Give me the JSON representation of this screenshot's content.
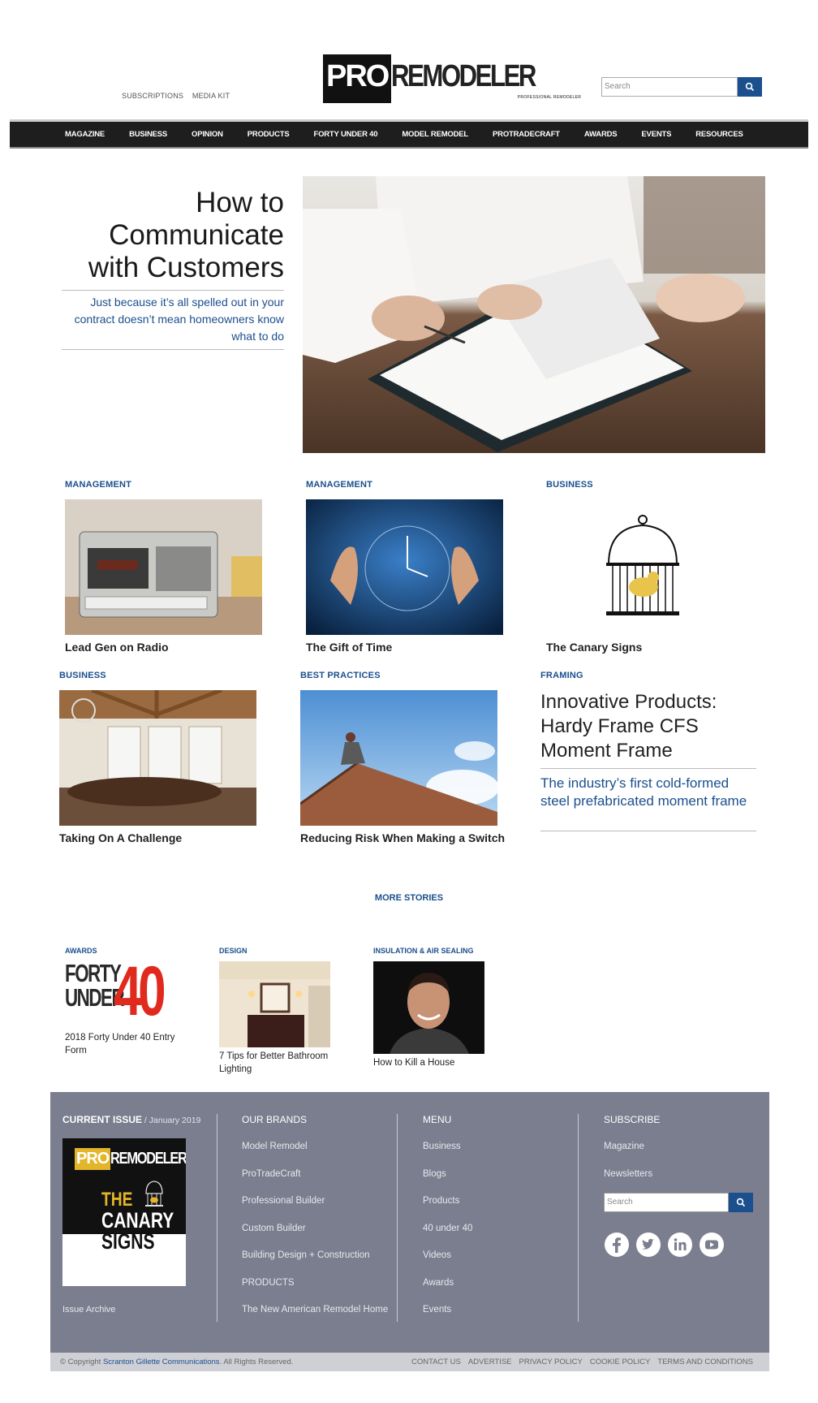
{
  "header": {
    "top_links": [
      "SUBSCRIPTIONS",
      "MEDIA KIT"
    ],
    "logo_pro": "PRO",
    "logo_rest": "REMODELER",
    "logo_sub": "PROFESSIONAL REMODELER",
    "search_placeholder": "Search"
  },
  "nav": [
    "MAGAZINE",
    "BUSINESS",
    "OPINION",
    "PRODUCTS",
    "FORTY UNDER 40",
    "MODEL REMODEL",
    "PROTRADECRAFT",
    "AWARDS",
    "EVENTS",
    "RESOURCES"
  ],
  "hero": {
    "title": "How to Communicate with Customers",
    "subtitle": "Just because it’s all spelled out in your contract doesn’t mean homeowners know what to do"
  },
  "grid_row1": [
    {
      "category": "MANAGEMENT",
      "caption": "Lead Gen on Radio"
    },
    {
      "category": "MANAGEMENT",
      "caption": "The Gift of Time"
    },
    {
      "category": "BUSINESS",
      "caption": "The Canary Signs"
    }
  ],
  "grid_row2": [
    {
      "category": "BUSINESS",
      "caption": "Taking On A Challenge"
    },
    {
      "category": "BEST PRACTICES",
      "caption": "Reducing Risk When Making a Switch"
    }
  ],
  "feature": {
    "category": "FRAMING",
    "title": "Innovative Products: Hardy Frame CFS Moment Frame",
    "subtitle": "The industry’s first cold-formed steel prefabricated moment frame"
  },
  "more_stories": "MORE STORIES",
  "small_stories": [
    {
      "category": "AWARDS",
      "caption": "2018 Forty Under 40 Entry Form",
      "logo_line1": "FORTY",
      "logo_line2": "UNDER",
      "logo_num": "40"
    },
    {
      "category": "DESIGN",
      "caption": "7 Tips for Better Bathroom Lighting"
    },
    {
      "category": "INSULATION & AIR SEALING",
      "caption": "How to Kill a House"
    }
  ],
  "footer": {
    "current_issue_label": "CURRENT ISSUE",
    "current_issue_date": " / January 2019",
    "cover_pro": "PRO",
    "cover_rest": "REMODELER",
    "cover_title_1": "THE",
    "cover_title_2": "CANARY",
    "cover_title_3": "SIGNS",
    "issue_archive": "Issue Archive",
    "brands_heading": "OUR BRANDS",
    "brands": [
      "Model Remodel",
      "ProTradeCraft",
      "Professional Builder",
      "Custom Builder",
      "Building Design + Construction",
      "PRODUCTS",
      "The New American Remodel Home"
    ],
    "menu_heading": "MENU",
    "menu": [
      "Business",
      "Blogs",
      "Products",
      "40 under 40",
      "Videos",
      "Awards",
      "Events"
    ],
    "subscribe_heading": "SUBSCRIBE",
    "subscribe": [
      "Magazine",
      "Newsletters"
    ],
    "search_placeholder": "Search",
    "copyright_prefix": "© Copyright ",
    "copyright_company": "Scranton Gillette Communications",
    "copyright_suffix": ". All Rights Reserved.",
    "bottom_links": [
      "CONTACT US",
      "ADVERTISE",
      "PRIVACY POLICY",
      "COOKIE POLICY",
      "TERMS AND CONDITIONS"
    ]
  },
  "colors": {
    "accent": "#1b4f8e",
    "nav_bg": "#1e1e1e",
    "footer_bg": "#7a7e8e",
    "forty_red": "#e02a1d"
  }
}
